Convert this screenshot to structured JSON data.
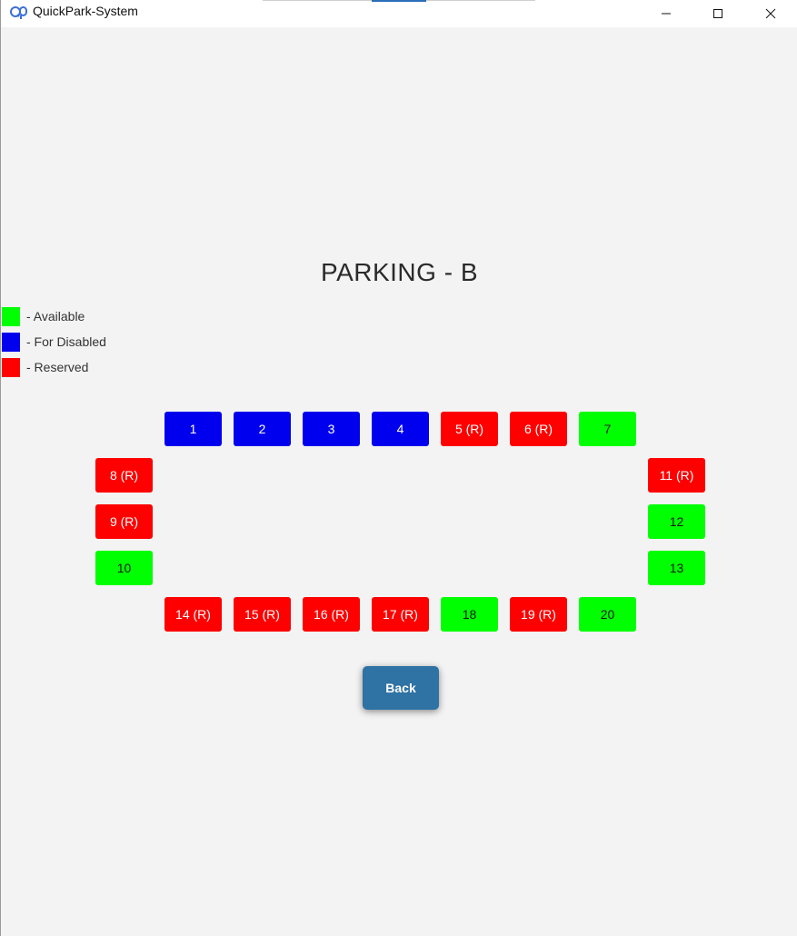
{
  "window": {
    "title": "QuickPark-System"
  },
  "page": {
    "title": "PARKING - B"
  },
  "legend": [
    {
      "label": "- Available",
      "color": "#00ff00"
    },
    {
      "label": "- For Disabled",
      "color": "#0000ee"
    },
    {
      "label": "- Reserved",
      "color": "#ff0000"
    }
  ],
  "spots": [
    {
      "label": "1",
      "status": "disabled"
    },
    {
      "label": "2",
      "status": "disabled"
    },
    {
      "label": "3",
      "status": "disabled"
    },
    {
      "label": "4",
      "status": "disabled"
    },
    {
      "label": "5 (R)",
      "status": "reserved"
    },
    {
      "label": "6 (R)",
      "status": "reserved"
    },
    {
      "label": "7",
      "status": "available"
    },
    {
      "label": "8 (R)",
      "status": "reserved"
    },
    {
      "label": "9 (R)",
      "status": "reserved"
    },
    {
      "label": "10",
      "status": "available"
    },
    {
      "label": "11 (R)",
      "status": "reserved"
    },
    {
      "label": "12",
      "status": "available"
    },
    {
      "label": "13",
      "status": "available"
    },
    {
      "label": "14 (R)",
      "status": "reserved"
    },
    {
      "label": "15 (R)",
      "status": "reserved"
    },
    {
      "label": "16 (R)",
      "status": "reserved"
    },
    {
      "label": "17 (R)",
      "status": "reserved"
    },
    {
      "label": "18",
      "status": "available"
    },
    {
      "label": "19 (R)",
      "status": "reserved"
    },
    {
      "label": "20",
      "status": "available"
    }
  ],
  "actions": {
    "back_label": "Back"
  }
}
